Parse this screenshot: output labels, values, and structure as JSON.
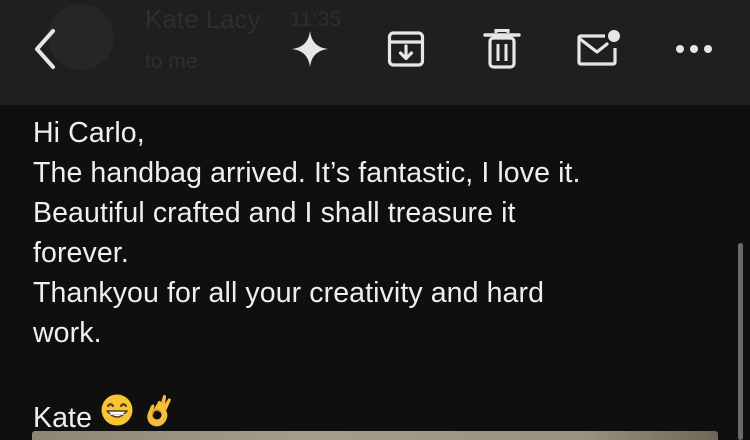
{
  "header": {
    "sender_name": "Kate Lacy",
    "time": "11:35",
    "recipient_line": "to me"
  },
  "toolbar": {
    "back_icon": "chevron-left-icon",
    "summarize_icon": "sparkle-icon",
    "archive_icon": "archive-icon",
    "delete_icon": "trash-icon",
    "mark_unread_icon": "mail-unread-icon",
    "more_icon": "more-horizontal-icon"
  },
  "message": {
    "lines": [
      "Hi Carlo,",
      "The handbag arrived. It’s fantastic, I love it.",
      "Beautiful crafted and I shall treasure it",
      "forever.",
      "Thankyou for all your creativity and hard",
      "work."
    ],
    "signature": "Kate",
    "signature_emojis": [
      "grinning-face-emoji",
      "ok-hand-emoji"
    ]
  },
  "colors": {
    "background": "#0f0f10",
    "toolbar": "#1f1f20",
    "text": "#efefef"
  }
}
